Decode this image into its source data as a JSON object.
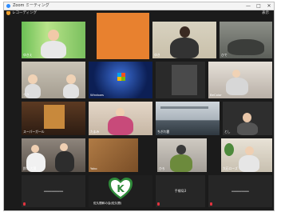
{
  "window": {
    "title": "Zoom ミーティング",
    "minimize": "—",
    "maximize": "□",
    "close": "✕"
  },
  "topbar": {
    "recording_label": "レコーディング",
    "view_label": "表示"
  },
  "participants": [
    {
      "name": "ゆきえ"
    },
    {
      "name": ""
    },
    {
      "name": "ゆき"
    },
    {
      "name": "ひで"
    },
    {
      "name": "りさ"
    },
    {
      "name": "Windows"
    },
    {
      "name": ""
    },
    {
      "name": "BeColor"
    },
    {
      "name": "スーパーガール"
    },
    {
      "name": "たまみ"
    },
    {
      "name": "ちぎれ雲"
    },
    {
      "name": "とし"
    },
    {
      "name": "鈴木 大翼"
    },
    {
      "name": "Yoko"
    },
    {
      "name": "ひろ"
    },
    {
      "name": "大石ローズ"
    },
    {
      "name": "━━━━━━━━━━━━",
      "center": "━━━━━━━━━━"
    },
    {
      "name": "佐久間和の会(佐久間)",
      "logo": "K"
    },
    {
      "name": "",
      "center": "手郷局3"
    },
    {
      "name": "",
      "center": "━━━━━━━━━"
    }
  ],
  "colors": {
    "active_speaker": "#9ccc2e",
    "pinned": "#4a90e2",
    "muted_mic": "#e0333e",
    "logo_green": "#2f8a3a"
  }
}
